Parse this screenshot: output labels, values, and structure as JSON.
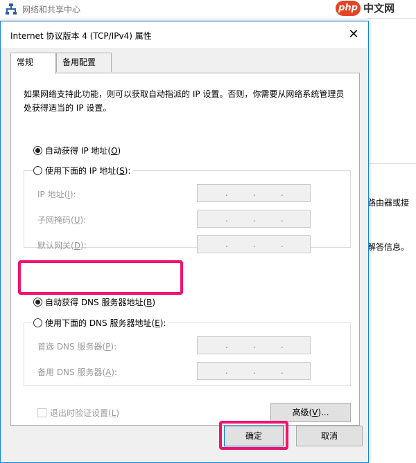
{
  "background_window": {
    "title": "网络和共享中心",
    "right_text_1": "路由器或接",
    "right_text_2": "解答信息。"
  },
  "watermark": {
    "brand": "php",
    "site": "中文网"
  },
  "dialog": {
    "title": "Internet 协议版本 4 (TCP/IPv4) 属性",
    "close_glyph": "✕",
    "tabs": [
      {
        "label": "常规",
        "active": true
      },
      {
        "label": "备用配置",
        "active": false
      }
    ],
    "description": "如果网络支持此功能，则可以获取自动指派的 IP 设置。否则，你需要从网络系统管理员处获得适当的 IP 设置。",
    "ip_section": {
      "auto_label": "自动获得 IP 地址(",
      "auto_key": "O",
      "manual_label": "使用下面的 IP 地址(",
      "manual_key": "S",
      "auto_selected": true,
      "fields": [
        {
          "label": "IP 地址(",
          "key": "I"
        },
        {
          "label": "子网掩码(",
          "key": "U"
        },
        {
          "label": "默认网关(",
          "key": "D"
        }
      ]
    },
    "dns_section": {
      "auto_label": "自动获得 DNS 服务器地址(",
      "auto_key": "B",
      "manual_label": "使用下面的 DNS 服务器地址(",
      "manual_key": "E",
      "auto_selected": true,
      "fields": [
        {
          "label": "首选 DNS 服务器(",
          "key": "P"
        },
        {
          "label": "备用 DNS 服务器(",
          "key": "A"
        }
      ]
    },
    "validate_label": "退出时验证设置(",
    "validate_key": "L",
    "advanced_label": "高级(",
    "advanced_key": "V",
    "advanced_suffix": ")...",
    "ok_label": "确定",
    "cancel_label": "取消",
    "paren_close": "):",
    "paren_close_plain": ")",
    "ip_dot": "."
  },
  "colors": {
    "highlight": "#f0146e",
    "accent": "#1784d6"
  }
}
